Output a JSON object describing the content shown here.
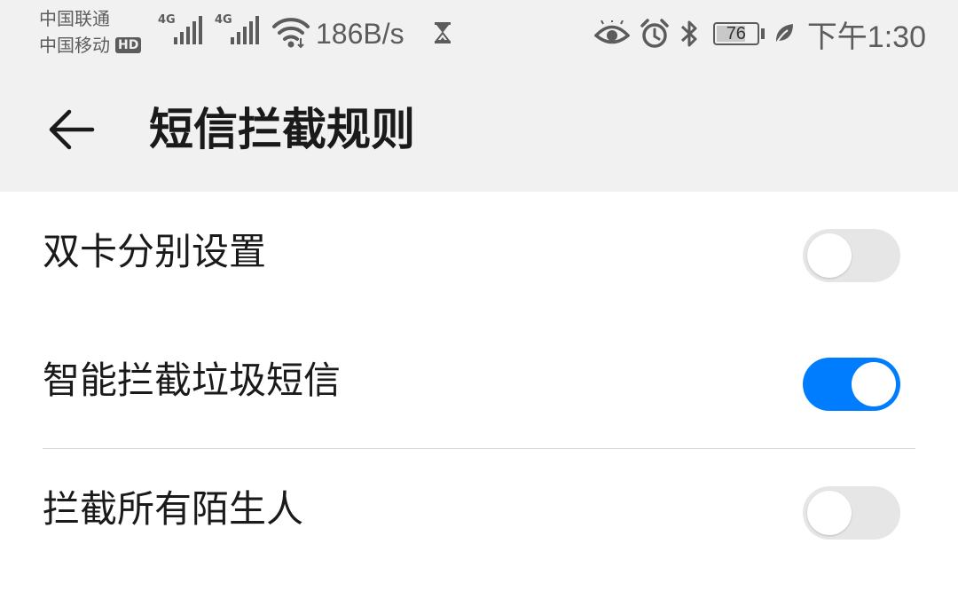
{
  "status_bar": {
    "carrier_1": "中国联通",
    "carrier_2": "中国移动",
    "carrier_2_badge": "HD",
    "signal_1_type": "4G",
    "signal_2_type": "4G",
    "network_speed": "186B/s",
    "battery_level": "76",
    "time": "下午1:30",
    "icons": [
      "signal-icon",
      "signal-icon",
      "wifi-icon",
      "hourglass-icon",
      "eye-comfort-icon",
      "alarm-icon",
      "bluetooth-icon",
      "battery-icon",
      "leaf-icon"
    ]
  },
  "header": {
    "back_icon": "back-arrow-icon",
    "title": "短信拦截规则"
  },
  "settings": {
    "items": [
      {
        "label": "双卡分别设置",
        "enabled": false
      },
      {
        "label": "智能拦截垃圾短信",
        "enabled": true
      },
      {
        "label": "拦截所有陌生人",
        "enabled": false
      }
    ]
  },
  "colors": {
    "accent": "#007dff",
    "toolbar_bg": "#f1f1f1",
    "toggle_off": "#e6e6e6"
  }
}
